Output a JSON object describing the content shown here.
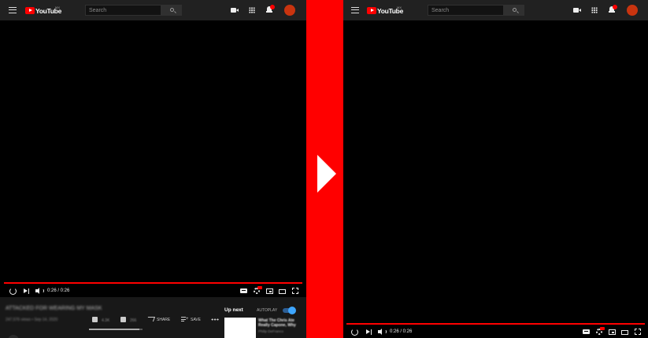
{
  "header": {
    "logo_text": "YouTube",
    "logo_region": "MX",
    "search_placeholder": "Search"
  },
  "player": {
    "time_display": "0:26 / 0:26",
    "progress_fraction": 1.0
  },
  "video": {
    "title": "ATTACKED FOR WEARING MY MASK",
    "meta": "247,576 views • Sep 14, 2020",
    "like_count": "4.3K",
    "dislike_count": "266",
    "share_label": "SHARE",
    "save_label": "SAVE",
    "like_ratio": 0.94
  },
  "sidebar": {
    "up_next_label": "Up next",
    "autoplay_label": "AUTOPLAY",
    "autoplay_on": true,
    "recommendation": {
      "title": "What The Chris Ate Really Capone, Why",
      "channel": "Philip DeFranco"
    }
  },
  "colors": {
    "accent": "#ff0000",
    "topbar": "#212121",
    "avatar": "#c9340f",
    "toggle": "#3ea6ff"
  }
}
